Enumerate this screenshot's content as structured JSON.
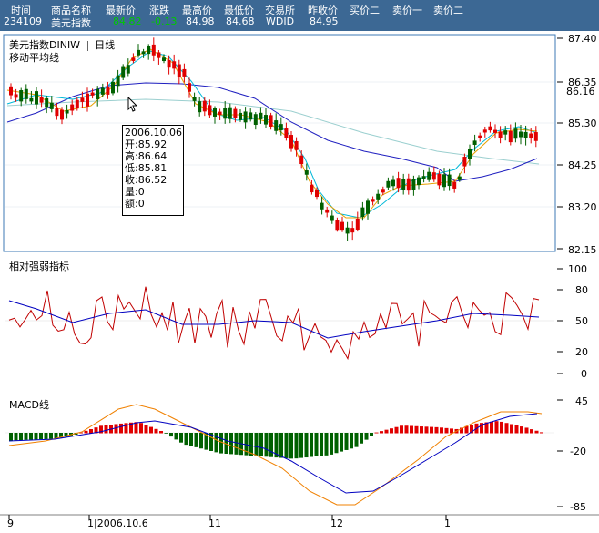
{
  "header": {
    "columns": [
      "时间",
      "商品名称",
      "最新价",
      "涨跌",
      "最高价",
      "最低价",
      "交易所",
      "昨收价",
      "买价二",
      "卖价一",
      "卖价二"
    ],
    "values": [
      "234109",
      "美元指数",
      "84.82",
      "-0.13",
      "84.98",
      "84.68",
      "WDID",
      "84.95",
      "",
      "",
      ""
    ],
    "value_colors": [
      "#ffffff",
      "#ffffff",
      "#00c800",
      "#00c800",
      "#ffffff",
      "#ffffff",
      "#ffffff",
      "#ffffff",
      "#ffffff",
      "#ffffff",
      "#ffffff"
    ]
  },
  "main_panel": {
    "title": "美元指数DINIW",
    "period": "日线",
    "indicator": "移动平均线",
    "price_labels": [
      "87.40",
      "86.35",
      "86.16",
      "85.30",
      "84.25",
      "83.20",
      "82.15"
    ]
  },
  "tooltip": {
    "date": "2006.10.06",
    "open": "开:85.92",
    "high": "高:86.64",
    "low": "低:85.81",
    "close": "收:86.52",
    "volume": "量:0",
    "amount": "额:0"
  },
  "rsi_panel": {
    "title": "相对强弱指标",
    "labels": [
      "100",
      "80",
      "50",
      "20",
      "0"
    ]
  },
  "macd_panel": {
    "title": "MACD线",
    "labels": [
      "45",
      "-20",
      "-85"
    ]
  },
  "date_axis": {
    "labels": [
      "9",
      "1|2006.10.6",
      "11",
      "12",
      "1"
    ]
  },
  "colors": {
    "header_bg": "#3c6894",
    "up_candle": "#e00000",
    "down_candle": "#006000",
    "ma_fast": "#e8a000",
    "ma_mid": "#00b8d8",
    "ma_slow": "#2020c0",
    "ma_long": "#9bcfcf",
    "rsi_fast": "#c00000",
    "rsi_slow": "#0000c0",
    "macd_dif": "#f08000",
    "macd_dea": "#0000c0"
  }
}
